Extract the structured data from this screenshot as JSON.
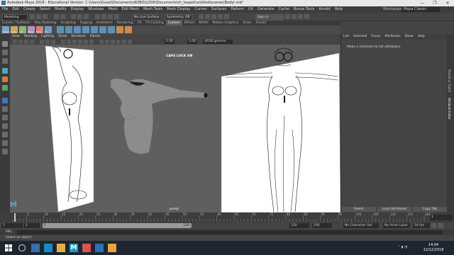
{
  "titlebar": {
    "title": "Autodesk Maya 2018 - Educational Version: C:\\Users\\Guest\\Documents\\KOBO\\LOOK\\Documents\\rh_teapot\\untitled\\scenes\\Bodyt.mb*",
    "min": "—",
    "max": "❐",
    "close": "✕"
  },
  "menubar": {
    "items": [
      "File",
      "Edit",
      "Create",
      "Select",
      "Modify",
      "Display",
      "Windows",
      "Mesh",
      "Edit Mesh",
      "Mesh Tools",
      "Mesh Display",
      "Curves",
      "Surfaces",
      "Deform",
      "UV",
      "Generate",
      "Cache",
      "Bonus Tools",
      "Arnold",
      "Help"
    ],
    "workspace_label": "Workspace :",
    "workspace_value": "Maya Classic"
  },
  "statusline": {
    "mode": "Modeling",
    "live_surface": "No Live Surface",
    "symmetry": "Symmetry: Off",
    "signin": "Sign In"
  },
  "shelf": {
    "tabs": [
      "Curves / Surfaces",
      "Poly Modeling",
      "Sculpting",
      "Rigging",
      "Animation",
      "Rendering",
      "FX",
      "FX Caching",
      "Custom",
      "Bifrost",
      "MASH",
      "Motion Graphics",
      "XGen",
      "Arnold"
    ],
    "active_tab": "Custom",
    "left_labels": [
      "Sphere",
      "Cube",
      "Cyl",
      "Plane",
      "Torus",
      "Pln"
    ]
  },
  "viewport": {
    "menu": [
      "View",
      "Shading",
      "Lighting",
      "Show",
      "Renderer",
      "Panels"
    ],
    "caps_lock": "CAPS LOCK ON",
    "camera": "persp",
    "val1": "0.00",
    "val2": "1.00",
    "colorspace": "sRGB gamma"
  },
  "rightpanel": {
    "tabs": [
      "List",
      "Selected",
      "Focus",
      "Attributes",
      "Show",
      "Help"
    ],
    "message": "Make a selection to list attributes.",
    "side_tabs": [
      "Modeling Toolkit",
      "Attribute Editor"
    ],
    "bottom_buttons": [
      "Select",
      "Load Attributes",
      "Copy Tab"
    ]
  },
  "timeline": {
    "ticks": [
      "5",
      "10",
      "15",
      "20",
      "25",
      "30",
      "35",
      "40",
      "45",
      "50",
      "55",
      "60",
      "65",
      "70",
      "75",
      "80",
      "85",
      "90",
      "95",
      "100",
      "105",
      "110",
      "115",
      "120"
    ],
    "current_frame": "1"
  },
  "range": {
    "start": "1",
    "start2": "1",
    "handle_start": "1",
    "handle_end": "120",
    "end": "120",
    "end2": "200",
    "character_set": "No Character Set",
    "anim_layer": "No Anim Layer",
    "fps": "24 fps"
  },
  "cmdline": {
    "label": "MEL"
  },
  "helpline": {
    "text": "Select an object"
  },
  "taskbar": {
    "time": "14:04",
    "date": "12/12/2018"
  }
}
